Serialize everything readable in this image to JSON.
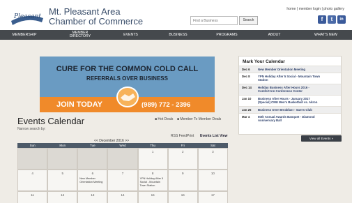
{
  "header": {
    "logo_text": "Pleasant",
    "org_line1": "Mt. Pleasant Area",
    "org_line2": "Chamber of Commerce",
    "find_placeholder": "Find a Business",
    "search_label": "Search",
    "top_links": [
      "home",
      "member login",
      "photo gallery"
    ],
    "social": [
      {
        "icon": "facebook-icon",
        "glyph": "f"
      },
      {
        "icon": "twitter-icon",
        "glyph": "t"
      },
      {
        "icon": "linkedin-icon",
        "glyph": "in"
      }
    ]
  },
  "nav": [
    "MEMBERSHIP",
    "MEMBER DIRECTORY",
    "EVENTS",
    "BUSINESS",
    "PROGRAMS",
    "ABOUT",
    "WHAT'S NEW"
  ],
  "banner": {
    "line1": "CURE FOR THE COMMON COLD CALL",
    "line2": "REFERRALS OVER BUSINESS",
    "join": "JOIN TODAY",
    "phone": "(989) 772 - 2396"
  },
  "events": {
    "title": "Events Calendar",
    "narrow": "Narrow search by: ",
    "hot_deals": "Hot Deals",
    "member_deals": "Member To Member Deals",
    "rss": "RSS Feed",
    "print": "Print",
    "list_view": "Events List View",
    "month_nav": "<<   December 2016   >>"
  },
  "calendar": {
    "days": [
      "Sun",
      "Mon",
      "Tue",
      "Wed",
      "Thu",
      "Fri",
      "Sat"
    ],
    "weeks": [
      [
        {
          "n": "",
          "g": true
        },
        {
          "n": "",
          "g": true
        },
        {
          "n": "",
          "g": true
        },
        {
          "n": "",
          "g": true
        },
        {
          "n": "1"
        },
        {
          "n": "2"
        },
        {
          "n": "3"
        }
      ],
      [
        {
          "n": "4"
        },
        {
          "n": "5"
        },
        {
          "n": "6",
          "e": [
            "New Member",
            "Orientation Meeting"
          ]
        },
        {
          "n": "7"
        },
        {
          "n": "8",
          "e": [
            "YPN Holiday After 5",
            "Social - Mountain",
            "Town Station"
          ]
        },
        {
          "n": "9"
        },
        {
          "n": "10"
        }
      ],
      [
        {
          "n": "11"
        },
        {
          "n": "12"
        },
        {
          "n": "13"
        },
        {
          "n": "14"
        },
        {
          "n": "15"
        },
        {
          "n": "16"
        },
        {
          "n": "17"
        }
      ]
    ]
  },
  "mark_calendar": {
    "title": "Mark Your Calendar",
    "items": [
      {
        "date": "Dec 6",
        "text": [
          "New Member Orientation Meeting"
        ]
      },
      {
        "date": "Dec 8",
        "text": [
          "YPN Holiday After 5 Social - Mountain Town",
          "Station"
        ]
      },
      {
        "date": "Dec 14",
        "text": [
          "Holiday Business After Hours 2016 -",
          "Comfort Inn Conference Center"
        ]
      },
      {
        "date": "Jan 10",
        "text": [
          "Business After Hours - January 2017",
          "(Special) CMU Men's Basketball vs. Akron"
        ]
      },
      {
        "date": "Jan 25",
        "text": [
          "Business Over Breakfast - Sam's Club"
        ]
      },
      {
        "date": "Mar 4",
        "text": [
          "60th Annual Awards Banquet - Diamond",
          "Anniversary Ball"
        ]
      }
    ],
    "view_all": "View all Events »"
  },
  "colors": {
    "nav_bg": "#45494d",
    "banner_blue": "#6a9bc2",
    "banner_orange": "#f08a2a",
    "link": "#2c3f6a"
  }
}
